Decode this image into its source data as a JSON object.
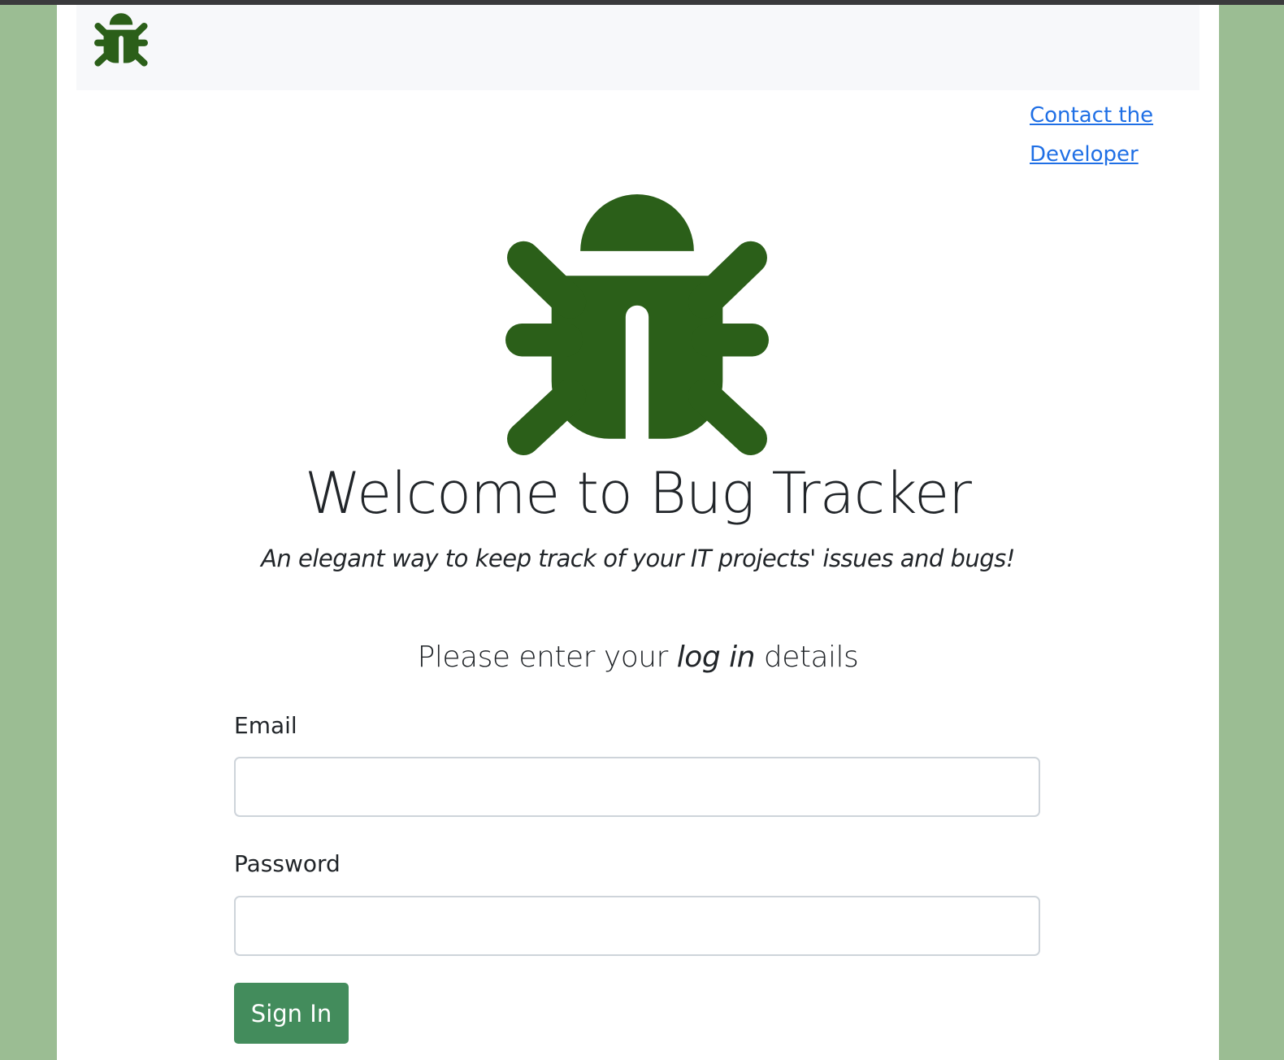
{
  "brand": {
    "logo_icon": "bug-icon",
    "accent_color": "#2b5f19"
  },
  "nav": {
    "contact_link": "Contact the Developer"
  },
  "hero": {
    "title": "Welcome to Bug Tracker",
    "subtitle": "An elegant way to keep track of your IT projects' issues and bugs!"
  },
  "login": {
    "heading_before": "Please enter your ",
    "heading_emphasis": "log in",
    "heading_after": " details",
    "email_label": "Email",
    "email_value": "",
    "password_label": "Password",
    "password_value": "",
    "submit_label": "Sign In",
    "button_color": "#438c5c"
  }
}
